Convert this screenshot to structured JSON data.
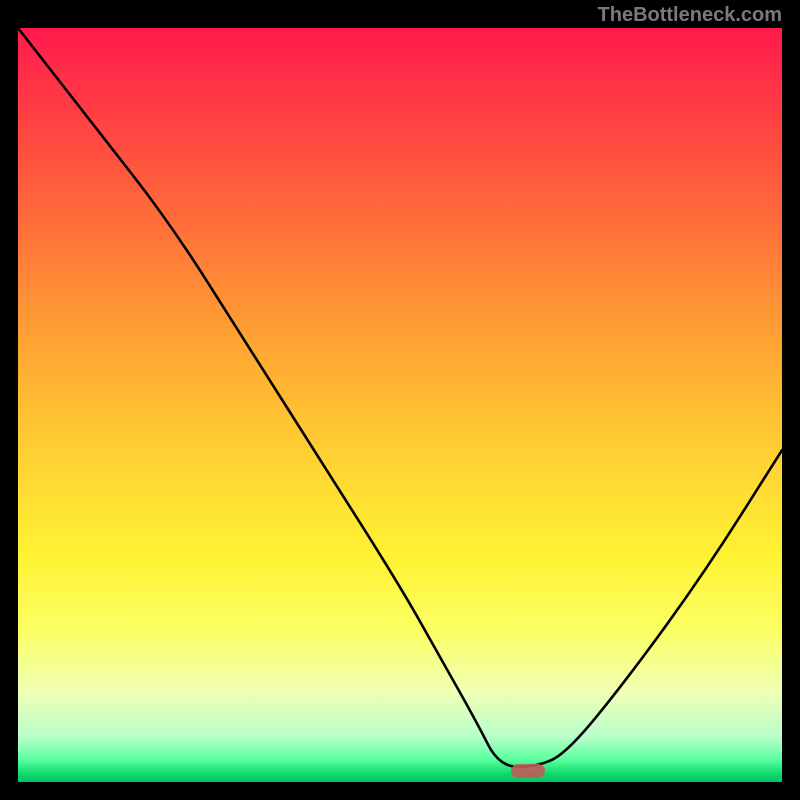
{
  "watermark": "TheBottleneck.com",
  "marker": {
    "x_frac": 0.668,
    "y_frac": 0.985
  },
  "chart_data": {
    "type": "line",
    "title": "",
    "xlabel": "",
    "ylabel": "",
    "xlim": [
      0,
      1
    ],
    "ylim": [
      0,
      1
    ],
    "series": [
      {
        "name": "curve",
        "x": [
          0.0,
          0.1,
          0.2,
          0.3,
          0.4,
          0.5,
          0.55,
          0.6,
          0.63,
          0.68,
          0.72,
          0.8,
          0.9,
          1.0
        ],
        "values": [
          1.0,
          0.87,
          0.74,
          0.58,
          0.42,
          0.26,
          0.17,
          0.08,
          0.02,
          0.02,
          0.04,
          0.14,
          0.28,
          0.44
        ]
      }
    ],
    "background_gradient": {
      "stops": [
        {
          "pos": 0.0,
          "color": "#ff1a4d"
        },
        {
          "pos": 0.5,
          "color": "#ffc433"
        },
        {
          "pos": 0.82,
          "color": "#fcff80"
        },
        {
          "pos": 1.0,
          "color": "#06c060"
        }
      ]
    },
    "marker": {
      "x": 0.668,
      "color": "#c05a5a"
    }
  }
}
